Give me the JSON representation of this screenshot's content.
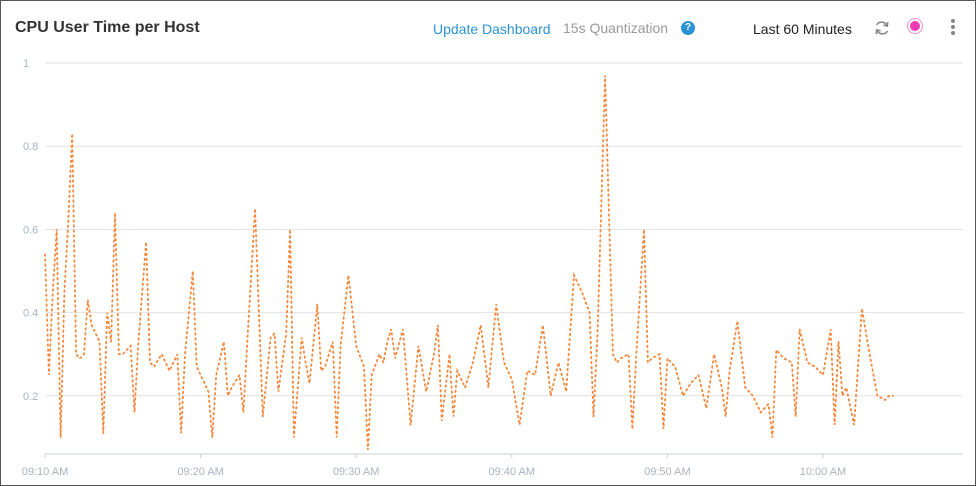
{
  "header": {
    "title": "CPU User Time per Host",
    "update_label": "Update Dashboard",
    "quantization_label": "15s Quantization",
    "help_glyph": "?",
    "time_range": "Last 60 Minutes",
    "refresh_icon": "refresh-icon",
    "live_icon": "live-indicator-icon",
    "menu_icon": "more-vertical-icon"
  },
  "colors": {
    "series": "#f5883c",
    "grid": "#e2e2e2",
    "link": "#2a93d5",
    "live": "#f03ab4"
  },
  "chart_data": {
    "type": "line",
    "title": "CPU User Time per Host",
    "line_style": "dotted",
    "ylim": [
      0,
      1
    ],
    "yticks": [
      "0.2",
      "0.4",
      "0.6",
      "0.8",
      "1"
    ],
    "x_start": "09:10",
    "x_end": "10:09",
    "xticks": [
      "09:10 AM",
      "09:20 AM",
      "09:30 AM",
      "09:40 AM",
      "09:50 AM",
      "10:00 AM"
    ],
    "grid": true,
    "series": [
      {
        "points": [
          [
            "09:10:00",
            0.54
          ],
          [
            "09:10:15",
            0.25
          ],
          [
            "09:10:30",
            0.45
          ],
          [
            "09:10:45",
            0.6
          ],
          [
            "09:11:00",
            0.1
          ],
          [
            "09:11:15",
            0.45
          ],
          [
            "09:11:30",
            0.62
          ],
          [
            "09:11:45",
            0.83
          ],
          [
            "09:12:00",
            0.3
          ],
          [
            "09:12:15",
            0.29
          ],
          [
            "09:12:30",
            0.3
          ],
          [
            "09:12:45",
            0.43
          ],
          [
            "09:13:00",
            0.37
          ],
          [
            "09:13:30",
            0.33
          ],
          [
            "09:13:45",
            0.11
          ],
          [
            "09:14:00",
            0.4
          ],
          [
            "09:14:15",
            0.33
          ],
          [
            "09:14:30",
            0.64
          ],
          [
            "09:14:45",
            0.3
          ],
          [
            "09:15:00",
            0.3
          ],
          [
            "09:15:30",
            0.32
          ],
          [
            "09:15:45",
            0.16
          ],
          [
            "09:16:00",
            0.33
          ],
          [
            "09:16:30",
            0.57
          ],
          [
            "09:16:45",
            0.28
          ],
          [
            "09:17:00",
            0.27
          ],
          [
            "09:17:30",
            0.3
          ],
          [
            "09:18:00",
            0.26
          ],
          [
            "09:18:30",
            0.3
          ],
          [
            "09:18:45",
            0.11
          ],
          [
            "09:19:00",
            0.3
          ],
          [
            "09:19:30",
            0.5
          ],
          [
            "09:19:45",
            0.27
          ],
          [
            "09:20:00",
            0.25
          ],
          [
            "09:20:30",
            0.21
          ],
          [
            "09:20:45",
            0.1
          ],
          [
            "09:21:00",
            0.25
          ],
          [
            "09:21:30",
            0.33
          ],
          [
            "09:21:45",
            0.2
          ],
          [
            "09:22:00",
            0.22
          ],
          [
            "09:22:30",
            0.25
          ],
          [
            "09:22:45",
            0.16
          ],
          [
            "09:23:00",
            0.33
          ],
          [
            "09:23:30",
            0.65
          ],
          [
            "09:24:00",
            0.15
          ],
          [
            "09:24:30",
            0.34
          ],
          [
            "09:24:45",
            0.35
          ],
          [
            "09:25:00",
            0.21
          ],
          [
            "09:25:30",
            0.35
          ],
          [
            "09:25:45",
            0.6
          ],
          [
            "09:26:00",
            0.1
          ],
          [
            "09:26:30",
            0.34
          ],
          [
            "09:26:45",
            0.28
          ],
          [
            "09:27:00",
            0.23
          ],
          [
            "09:27:30",
            0.42
          ],
          [
            "09:27:45",
            0.26
          ],
          [
            "09:28:00",
            0.27
          ],
          [
            "09:28:30",
            0.33
          ],
          [
            "09:28:45",
            0.1
          ],
          [
            "09:29:00",
            0.32
          ],
          [
            "09:29:30",
            0.49
          ],
          [
            "09:30:00",
            0.32
          ],
          [
            "09:30:30",
            0.27
          ],
          [
            "09:30:45",
            0.07
          ],
          [
            "09:31:00",
            0.25
          ],
          [
            "09:31:30",
            0.3
          ],
          [
            "09:31:45",
            0.28
          ],
          [
            "09:32:00",
            0.33
          ],
          [
            "09:32:15",
            0.36
          ],
          [
            "09:32:30",
            0.29
          ],
          [
            "09:33:00",
            0.36
          ],
          [
            "09:33:30",
            0.13
          ],
          [
            "09:34:00",
            0.32
          ],
          [
            "09:34:30",
            0.21
          ],
          [
            "09:35:00",
            0.3
          ],
          [
            "09:35:15",
            0.37
          ],
          [
            "09:35:30",
            0.14
          ],
          [
            "09:36:00",
            0.3
          ],
          [
            "09:36:15",
            0.15
          ],
          [
            "09:36:30",
            0.26
          ],
          [
            "09:37:00",
            0.22
          ],
          [
            "09:37:30",
            0.28
          ],
          [
            "09:38:00",
            0.37
          ],
          [
            "09:38:30",
            0.22
          ],
          [
            "09:39:00",
            0.42
          ],
          [
            "09:39:30",
            0.28
          ],
          [
            "09:40:00",
            0.24
          ],
          [
            "09:40:30",
            0.13
          ],
          [
            "09:41:00",
            0.26
          ],
          [
            "09:41:30",
            0.25
          ],
          [
            "09:42:00",
            0.37
          ],
          [
            "09:42:30",
            0.2
          ],
          [
            "09:43:00",
            0.28
          ],
          [
            "09:43:30",
            0.21
          ],
          [
            "09:44:00",
            0.49
          ],
          [
            "09:44:30",
            0.45
          ],
          [
            "09:45:00",
            0.4
          ],
          [
            "09:45:15",
            0.15
          ],
          [
            "09:45:30",
            0.34
          ],
          [
            "09:46:00",
            0.97
          ],
          [
            "09:46:30",
            0.3
          ],
          [
            "09:46:45",
            0.28
          ],
          [
            "09:47:00",
            0.29
          ],
          [
            "09:47:30",
            0.3
          ],
          [
            "09:47:45",
            0.12
          ],
          [
            "09:48:00",
            0.3
          ],
          [
            "09:48:30",
            0.6
          ],
          [
            "09:48:45",
            0.28
          ],
          [
            "09:49:00",
            0.29
          ],
          [
            "09:49:30",
            0.3
          ],
          [
            "09:49:45",
            0.12
          ],
          [
            "09:50:00",
            0.29
          ],
          [
            "09:50:30",
            0.27
          ],
          [
            "09:51:00",
            0.2
          ],
          [
            "09:51:30",
            0.23
          ],
          [
            "09:52:00",
            0.25
          ],
          [
            "09:52:30",
            0.17
          ],
          [
            "09:53:00",
            0.3
          ],
          [
            "09:53:30",
            0.22
          ],
          [
            "09:53:45",
            0.15
          ],
          [
            "09:54:00",
            0.26
          ],
          [
            "09:54:30",
            0.38
          ],
          [
            "09:55:00",
            0.22
          ],
          [
            "09:55:30",
            0.2
          ],
          [
            "09:56:00",
            0.16
          ],
          [
            "09:56:30",
            0.18
          ],
          [
            "09:56:45",
            0.1
          ],
          [
            "09:57:00",
            0.31
          ],
          [
            "09:57:30",
            0.29
          ],
          [
            "09:58:00",
            0.28
          ],
          [
            "09:58:15",
            0.15
          ],
          [
            "09:58:30",
            0.36
          ],
          [
            "09:59:00",
            0.28
          ],
          [
            "09:59:30",
            0.27
          ],
          [
            "10:00:00",
            0.25
          ],
          [
            "10:00:30",
            0.36
          ],
          [
            "10:00:45",
            0.13
          ],
          [
            "10:01:00",
            0.33
          ],
          [
            "10:01:15",
            0.2
          ],
          [
            "10:01:30",
            0.22
          ],
          [
            "10:02:00",
            0.13
          ],
          [
            "10:02:30",
            0.41
          ],
          [
            "10:03:00",
            0.3
          ],
          [
            "10:03:30",
            0.2
          ],
          [
            "10:04:00",
            0.19
          ],
          [
            "10:04:15",
            0.2
          ],
          [
            "10:04:30",
            0.2
          ]
        ]
      }
    ]
  }
}
